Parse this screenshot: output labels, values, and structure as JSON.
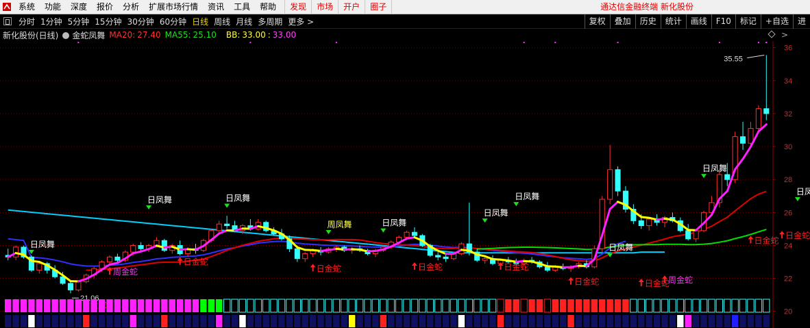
{
  "menubar": {
    "items": [
      "系统",
      "功能",
      "深度",
      "报价",
      "分析",
      "扩展市场行情",
      "资讯",
      "工具",
      "帮助"
    ],
    "red_items": [
      "发现",
      "市场",
      "开户",
      "圈子"
    ],
    "right_text": "通达信金融终端  新化股份"
  },
  "periodbar": {
    "items": [
      "分时",
      "1分钟",
      "5分钟",
      "15分钟",
      "30分钟",
      "60分钟",
      "日线",
      "周线",
      "月线",
      "多周期",
      "更多 >"
    ],
    "active": "日线",
    "tools": [
      "复权",
      "叠加",
      "历史",
      "统计",
      "画线",
      "F10",
      "标记",
      "+自选",
      "进"
    ]
  },
  "info": {
    "stock": "新化股份(日线)",
    "indicator": "金蛇凤舞",
    "ma20_label": "MA20:",
    "ma20_value": "27.40",
    "ma55_label": "MA55:",
    "ma55_value": "25.10",
    "bb_label": "BB:",
    "bb_value": "33.00",
    "bb_sep": ":",
    "bb_value2": "33.00",
    "diamond_icon": "diamond-icon",
    "chevron_icon": "chevron-right-icon"
  },
  "chart_data": {
    "type": "candlestick",
    "y_ticks": [
      20,
      22,
      24,
      26,
      28,
      30,
      32,
      34,
      36
    ],
    "ylim": [
      19.2,
      36.4
    ],
    "grid": true,
    "candles": [
      [
        23.4,
        23.8,
        23.1,
        23.3
      ],
      [
        23.3,
        24.0,
        23.1,
        23.9
      ],
      [
        23.9,
        24.0,
        23.2,
        23.3
      ],
      [
        23.3,
        23.4,
        22.4,
        22.5
      ],
      [
        22.5,
        23.0,
        22.3,
        22.9
      ],
      [
        22.9,
        23.0,
        22.3,
        22.5
      ],
      [
        22.5,
        22.8,
        22.0,
        22.1
      ],
      [
        22.1,
        22.4,
        21.6,
        21.7
      ],
      [
        21.7,
        21.9,
        21.1,
        21.3
      ],
      [
        21.3,
        21.9,
        21.2,
        21.8
      ],
      [
        21.8,
        22.3,
        21.7,
        22.2
      ],
      [
        22.2,
        22.7,
        22.0,
        22.6
      ],
      [
        22.6,
        23.1,
        22.4,
        23.0
      ],
      [
        23.0,
        23.4,
        22.8,
        23.3
      ],
      [
        23.3,
        23.5,
        22.9,
        23.1
      ],
      [
        23.1,
        23.7,
        23.0,
        23.6
      ],
      [
        23.6,
        24.1,
        23.4,
        24.0
      ],
      [
        24.0,
        24.2,
        23.6,
        23.8
      ],
      [
        23.8,
        24.1,
        23.6,
        24.0
      ],
      [
        24.0,
        24.5,
        23.9,
        24.3
      ],
      [
        24.3,
        24.4,
        23.6,
        23.7
      ],
      [
        23.7,
        24.1,
        23.5,
        24.0
      ],
      [
        24.0,
        24.3,
        23.4,
        23.5
      ],
      [
        23.5,
        23.9,
        23.3,
        23.8
      ],
      [
        23.8,
        24.1,
        23.5,
        23.7
      ],
      [
        23.7,
        24.4,
        23.6,
        24.3
      ],
      [
        24.3,
        25.0,
        24.2,
        24.9
      ],
      [
        24.9,
        25.5,
        24.7,
        25.3
      ],
      [
        25.3,
        25.8,
        25.0,
        25.2
      ],
      [
        25.2,
        25.5,
        24.8,
        24.9
      ],
      [
        24.9,
        25.3,
        24.7,
        25.2
      ],
      [
        25.2,
        25.6,
        24.9,
        25.0
      ],
      [
        25.0,
        25.6,
        24.9,
        25.4
      ],
      [
        25.4,
        25.5,
        24.8,
        24.9
      ],
      [
        24.9,
        25.1,
        24.6,
        24.7
      ],
      [
        24.7,
        25.0,
        24.3,
        24.4
      ],
      [
        24.4,
        24.6,
        23.6,
        23.8
      ],
      [
        23.8,
        24.0,
        23.0,
        23.2
      ],
      [
        23.2,
        23.6,
        23.0,
        23.5
      ],
      [
        23.5,
        23.8,
        23.3,
        23.7
      ],
      [
        23.7,
        23.9,
        23.4,
        23.6
      ],
      [
        23.6,
        23.9,
        23.5,
        23.8
      ],
      [
        23.8,
        24.0,
        23.6,
        23.9
      ],
      [
        23.9,
        24.0,
        23.6,
        23.7
      ],
      [
        23.7,
        23.9,
        23.5,
        23.8
      ],
      [
        23.8,
        24.0,
        23.6,
        23.7
      ],
      [
        23.7,
        23.8,
        23.4,
        23.5
      ],
      [
        23.5,
        23.8,
        23.3,
        23.7
      ],
      [
        23.7,
        24.0,
        23.6,
        23.9
      ],
      [
        23.9,
        24.3,
        23.8,
        24.2
      ],
      [
        24.2,
        24.6,
        24.1,
        24.5
      ],
      [
        24.5,
        24.9,
        24.4,
        24.8
      ],
      [
        24.8,
        25.1,
        24.5,
        24.6
      ],
      [
        24.6,
        24.7,
        23.9,
        24.0
      ],
      [
        24.0,
        24.1,
        23.3,
        23.4
      ],
      [
        23.4,
        23.6,
        23.1,
        23.3
      ],
      [
        23.3,
        23.5,
        23.0,
        23.2
      ],
      [
        23.2,
        23.6,
        23.1,
        23.5
      ],
      [
        23.5,
        24.2,
        23.4,
        24.1
      ],
      [
        24.1,
        26.6,
        23.4,
        23.6
      ],
      [
        23.6,
        23.8,
        23.0,
        23.1
      ],
      [
        23.1,
        23.4,
        22.9,
        23.2
      ],
      [
        23.2,
        23.4,
        22.8,
        22.9
      ],
      [
        22.9,
        23.2,
        22.7,
        23.1
      ],
      [
        23.1,
        23.3,
        22.9,
        23.0
      ],
      [
        23.0,
        23.2,
        22.8,
        22.9
      ],
      [
        22.9,
        23.2,
        22.8,
        23.1
      ],
      [
        23.1,
        23.3,
        22.9,
        23.0
      ],
      [
        23.0,
        23.1,
        22.6,
        22.7
      ],
      [
        22.7,
        23.0,
        22.4,
        22.5
      ],
      [
        22.5,
        22.8,
        22.4,
        22.7
      ],
      [
        22.7,
        22.9,
        22.5,
        22.6
      ],
      [
        22.6,
        22.8,
        22.4,
        22.7
      ],
      [
        22.7,
        23.0,
        22.6,
        22.9
      ],
      [
        22.9,
        23.1,
        22.6,
        22.7
      ],
      [
        22.7,
        24.0,
        22.6,
        23.8
      ],
      [
        23.8,
        27.0,
        23.6,
        26.8
      ],
      [
        26.8,
        30.1,
        26.5,
        28.6
      ],
      [
        28.6,
        28.8,
        27.0,
        27.3
      ],
      [
        27.3,
        27.6,
        26.0,
        26.2
      ],
      [
        26.2,
        26.5,
        25.3,
        25.5
      ],
      [
        25.5,
        25.9,
        25.0,
        25.2
      ],
      [
        25.2,
        25.7,
        24.9,
        25.6
      ],
      [
        25.6,
        25.9,
        25.2,
        25.4
      ],
      [
        25.4,
        25.8,
        25.1,
        25.7
      ],
      [
        25.7,
        26.0,
        25.4,
        25.5
      ],
      [
        25.5,
        25.7,
        24.8,
        24.9
      ],
      [
        24.9,
        25.3,
        24.3,
        24.4
      ],
      [
        24.4,
        25.0,
        24.2,
        24.9
      ],
      [
        24.9,
        26.1,
        24.8,
        26.0
      ],
      [
        26.0,
        27.0,
        25.8,
        26.6
      ],
      [
        26.6,
        28.6,
        26.3,
        28.3
      ],
      [
        28.3,
        29.0,
        27.6,
        28.0
      ],
      [
        28.0,
        30.9,
        27.8,
        30.6
      ],
      [
        30.6,
        31.5,
        29.8,
        30.2
      ],
      [
        30.2,
        31.5,
        30.0,
        31.1
      ],
      [
        31.1,
        32.5,
        30.8,
        32.3
      ],
      [
        32.3,
        35.55,
        31.6,
        32.0
      ]
    ],
    "ma20_last": 27.4,
    "ma55_last": 25.1,
    "high_label": "35.55",
    "low_label": "21.06",
    "signals": [
      {
        "text": "日凤舞",
        "i": 3,
        "y": 23.4,
        "color": "#ffffff"
      },
      {
        "text": "日金蛇",
        "i": 9,
        "y": 20.6,
        "color": "#ff2020"
      },
      {
        "text": "周金蛇",
        "i": 13,
        "y": 22.6,
        "color": "#ff30ff"
      },
      {
        "text": "日凤舞",
        "i": 18,
        "y": 26.1,
        "color": "#ffffff"
      },
      {
        "text": "日金蛇",
        "i": 22,
        "y": 23.2,
        "color": "#ff2020"
      },
      {
        "text": "日凤舞",
        "i": 28,
        "y": 26.2,
        "color": "#ffffff"
      },
      {
        "text": "日金蛇",
        "i": 39,
        "y": 22.8,
        "color": "#ff2020"
      },
      {
        "text": "周凤舞",
        "i": 41,
        "y": 24.6,
        "color": "#ffff40"
      },
      {
        "text": "日凤舞",
        "i": 48,
        "y": 24.7,
        "color": "#ffffff"
      },
      {
        "text": "日金蛇",
        "i": 52,
        "y": 22.9,
        "color": "#ff2020"
      },
      {
        "text": "日凤舞",
        "i": 61,
        "y": 25.3,
        "color": "#ffffff"
      },
      {
        "text": "日金蛇",
        "i": 63,
        "y": 22.9,
        "color": "#ff2020"
      },
      {
        "text": "日凤舞",
        "i": 65,
        "y": 26.3,
        "color": "#ffffff"
      },
      {
        "text": "日金蛇",
        "i": 72,
        "y": 22.0,
        "color": "#ff2020"
      },
      {
        "text": "日凤舞",
        "i": 77,
        "y": 23.2,
        "color": "#ffffff"
      },
      {
        "text": "日金蛇",
        "i": 81,
        "y": 21.9,
        "color": "#ff2020"
      },
      {
        "text": "周金蛇",
        "i": 84,
        "y": 22.1,
        "color": "#ff30ff"
      },
      {
        "text": "日凤舞",
        "i": 89,
        "y": 28.0,
        "color": "#ffffff"
      },
      {
        "text": "日金蛇",
        "i": 95,
        "y": 24.5,
        "color": "#ff2020"
      },
      {
        "text": "日金蛇",
        "i": 99,
        "y": 24.8,
        "color": "#ff2020"
      },
      {
        "text": "日凤舞",
        "i": 101,
        "y": 26.6,
        "color": "#ffffff"
      },
      {
        "text": "日金蛇",
        "i": 104,
        "y": 23.8,
        "color": "#ff2020"
      }
    ],
    "colors": {
      "up": "#ff3030",
      "down": "#33ffff",
      "ma20": "#e00000",
      "ma55": "#00e000",
      "slow": "#00d0ff",
      "mid": "#3030ff",
      "yellow": "#ffff00",
      "magenta": "#ff20ff"
    }
  }
}
